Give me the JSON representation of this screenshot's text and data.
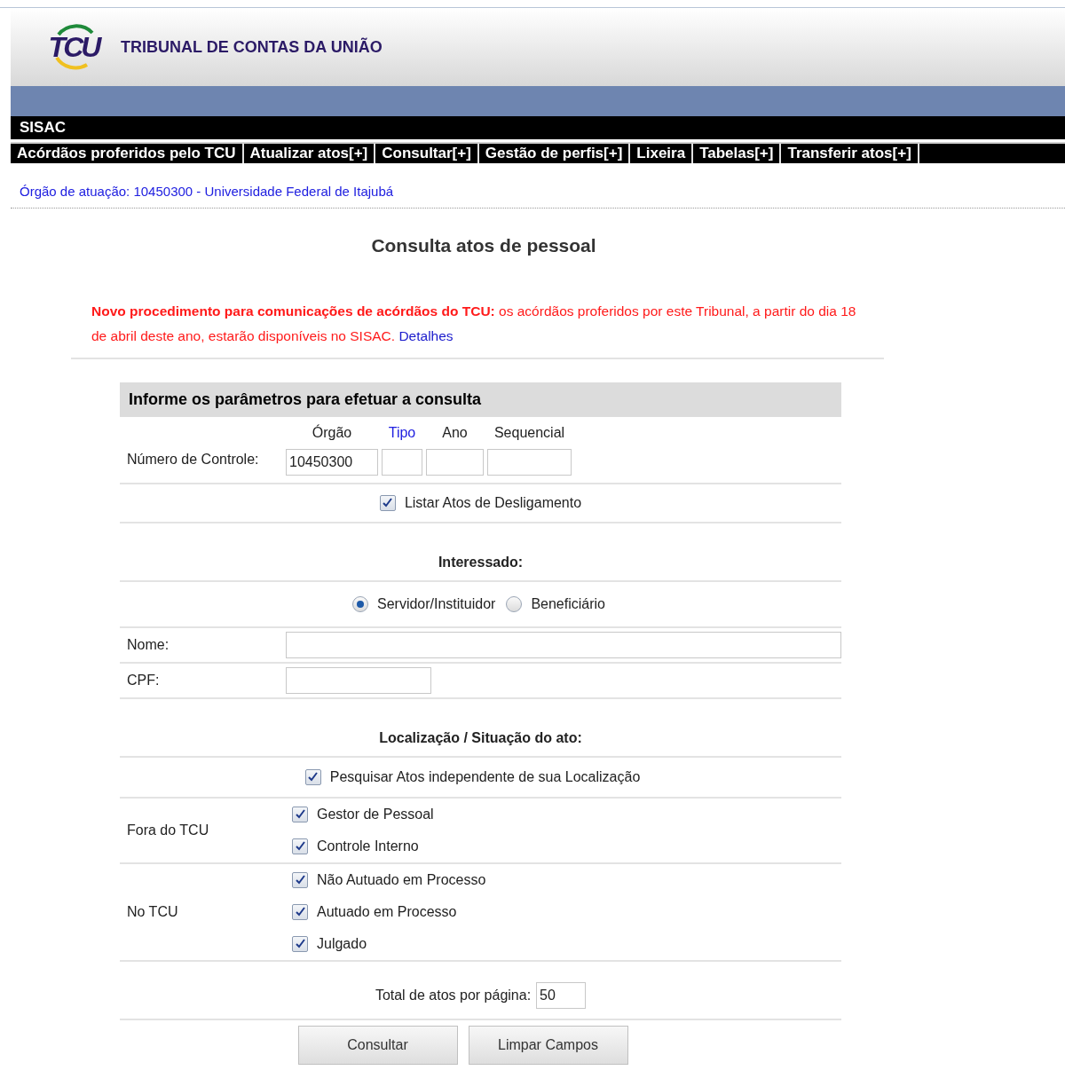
{
  "header": {
    "logo": "TCU",
    "title": "TRIBUNAL DE CONTAS DA UNIÃO"
  },
  "system": "SISAC",
  "menu": [
    "Acórdãos proferidos pelo TCU",
    "Atualizar atos[+]",
    "Consultar[+]",
    "Gestão de perfis[+]",
    "Lixeira",
    "Tabelas[+]",
    "Transferir atos[+]"
  ],
  "org": "Órgão de atuação: 10450300 - Universidade Federal de Itajubá",
  "page_title": "Consulta atos de pessoal",
  "notice": {
    "text": "**Novo procedimento para comunicações de acórdãos do TCU:** os acórdãos proferidos por este Tribunal, a partir do dia 18 de abril deste ano, estarão disponíveis no SISAC.",
    "link": "Detalhes"
  },
  "form": {
    "heading": "Informe os parâmetros para efetuar a consulta",
    "control": {
      "label": "Número de Controle:",
      "parts": [
        {
          "header": "Órgão",
          "value": "10450300",
          "link": false
        },
        {
          "header": "Tipo",
          "link": true
        },
        {
          "header": "Ano",
          "link": false
        },
        {
          "header": "Sequencial",
          "link": false
        }
      ]
    },
    "desligamento": {
      "label": "Listar Atos de Desligamento",
      "checked": true
    },
    "interessado": {
      "heading": "Interessado:",
      "options": [
        {
          "label": "Servidor/Instituidor",
          "selected": true
        },
        {
          "label": "Beneficiário",
          "selected": false
        }
      ]
    },
    "nome": {
      "label": "Nome:"
    },
    "cpf": {
      "label": "CPF:"
    },
    "localizacao": {
      "heading": "Localização / Situação do ato:",
      "all": {
        "label": "Pesquisar Atos independente de sua Localização",
        "checked": true
      },
      "groups": [
        {
          "label": "Fora do TCU",
          "items": [
            {
              "label": "Gestor de Pessoal",
              "checked": true
            },
            {
              "label": "Controle Interno",
              "checked": true
            }
          ]
        },
        {
          "label": "No TCU",
          "items": [
            {
              "label": "Não Autuado em Processo",
              "checked": true
            },
            {
              "label": "Autuado em Processo",
              "checked": true
            },
            {
              "label": "Julgado",
              "checked": true
            }
          ]
        }
      ]
    },
    "per_page": {
      "label": "Total de atos por página:",
      "value": "50"
    },
    "buttons": [
      "Consultar",
      "Limpar Campos"
    ]
  }
}
